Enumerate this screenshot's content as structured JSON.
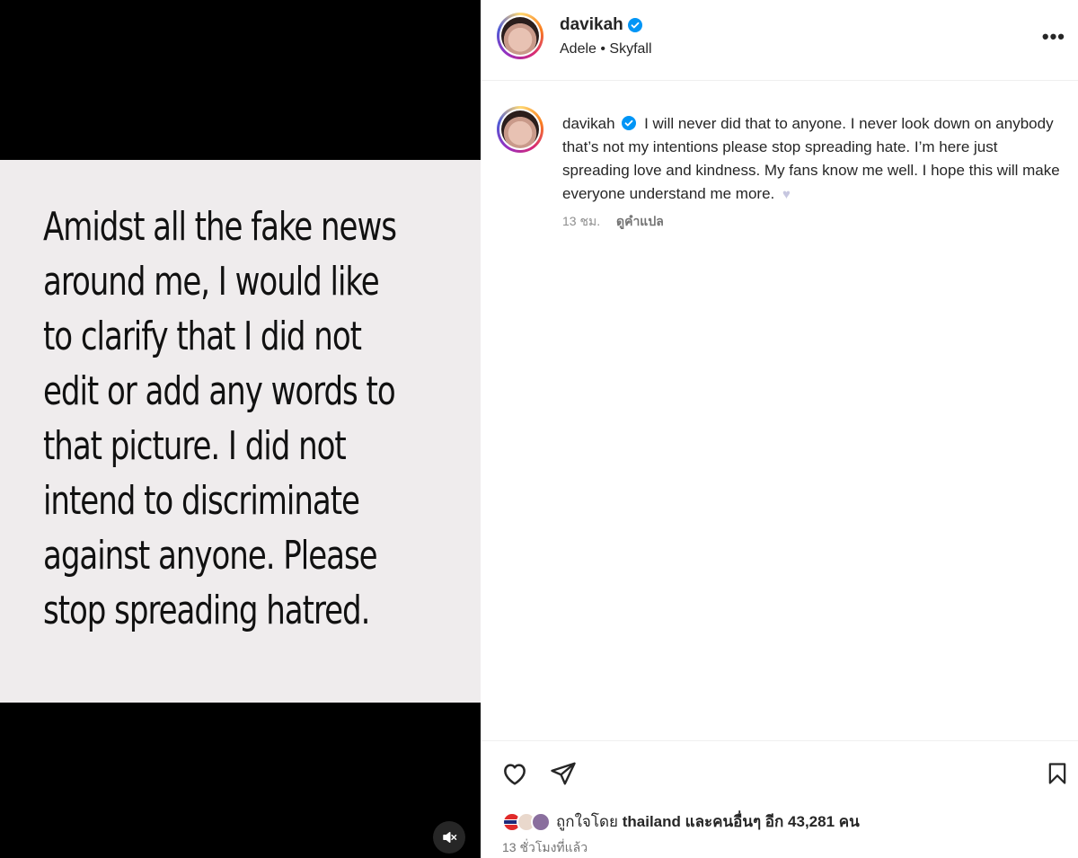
{
  "post": {
    "image_text_lines": [
      "Amidst all the fake news",
      "around me, I would like",
      "to clarify that I did not",
      "edit or add any words to",
      "that picture. I did not",
      "intend to discriminate",
      "against anyone. Please",
      "stop spreading hatred."
    ]
  },
  "header": {
    "username": "davikah",
    "audio": "Adele • Skyfall",
    "more_label": "•••"
  },
  "caption": {
    "username": "davikah",
    "text": "I will never did that to anyone. I never look down on anybody that’s not my intentions please stop spreading hate. I’m here just spreading love and kindness. My fans know me well. I hope this will make everyone understand me more.",
    "emoji": "♥",
    "time": "13 ชม.",
    "translate_label": "ดูคำแปล"
  },
  "likes": {
    "prefix": "ถูกใจโดย",
    "user": "thailand",
    "suffix": "และคนอื่นๆ อีก 43,281 คน",
    "time_ago": "13 ชั่วโมงที่แล้ว"
  },
  "colors": {
    "verified": "#0095f6",
    "card_bg": "#efeced",
    "media_bg": "#000000"
  }
}
